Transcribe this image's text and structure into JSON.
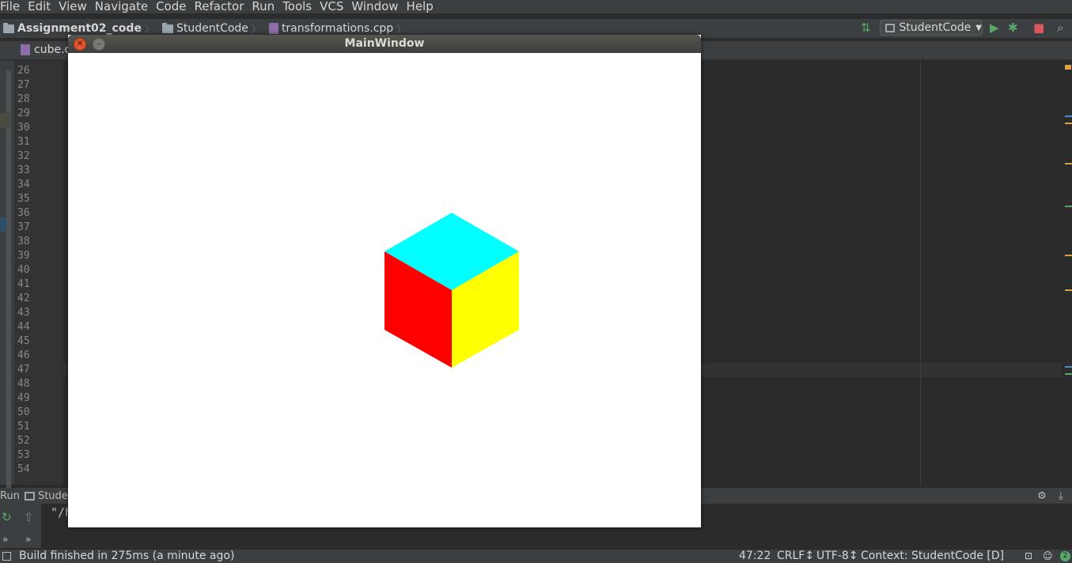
{
  "menu": [
    "File",
    "Edit",
    "View",
    "Navigate",
    "Code",
    "Refactor",
    "Run",
    "Tools",
    "VCS",
    "Window",
    "Help"
  ],
  "breadcrumb": {
    "project": "Assignment02_code",
    "folder": "StudentCode",
    "file": "transformations.cpp"
  },
  "toolbar": {
    "run_config": "StudentCode"
  },
  "editor": {
    "tab_label": "cube.c",
    "line_numbers": [
      "26",
      "27",
      "28",
      "29",
      "30",
      "31",
      "32",
      "33",
      "34",
      "35",
      "36",
      "37",
      "38",
      "39",
      "40",
      "41",
      "42",
      "43",
      "44",
      "45",
      "46",
      "47",
      "48",
      "49",
      "50",
      "51",
      "52",
      "53",
      "54"
    ]
  },
  "run_panel": {
    "title": "Run",
    "config_tab": "Student",
    "output": "\"/h"
  },
  "status": {
    "message": "Build finished in 275ms (a minute ago)",
    "position": "47:22",
    "line_sep": "CRLF↕",
    "encoding": "UTF-8↕",
    "context": "Context: StudentCode [D]"
  },
  "main_window": {
    "title": "MainWindow"
  },
  "colors": {
    "cube_top": "#00ffff",
    "cube_left": "#ff0000",
    "cube_right": "#ffff00"
  }
}
